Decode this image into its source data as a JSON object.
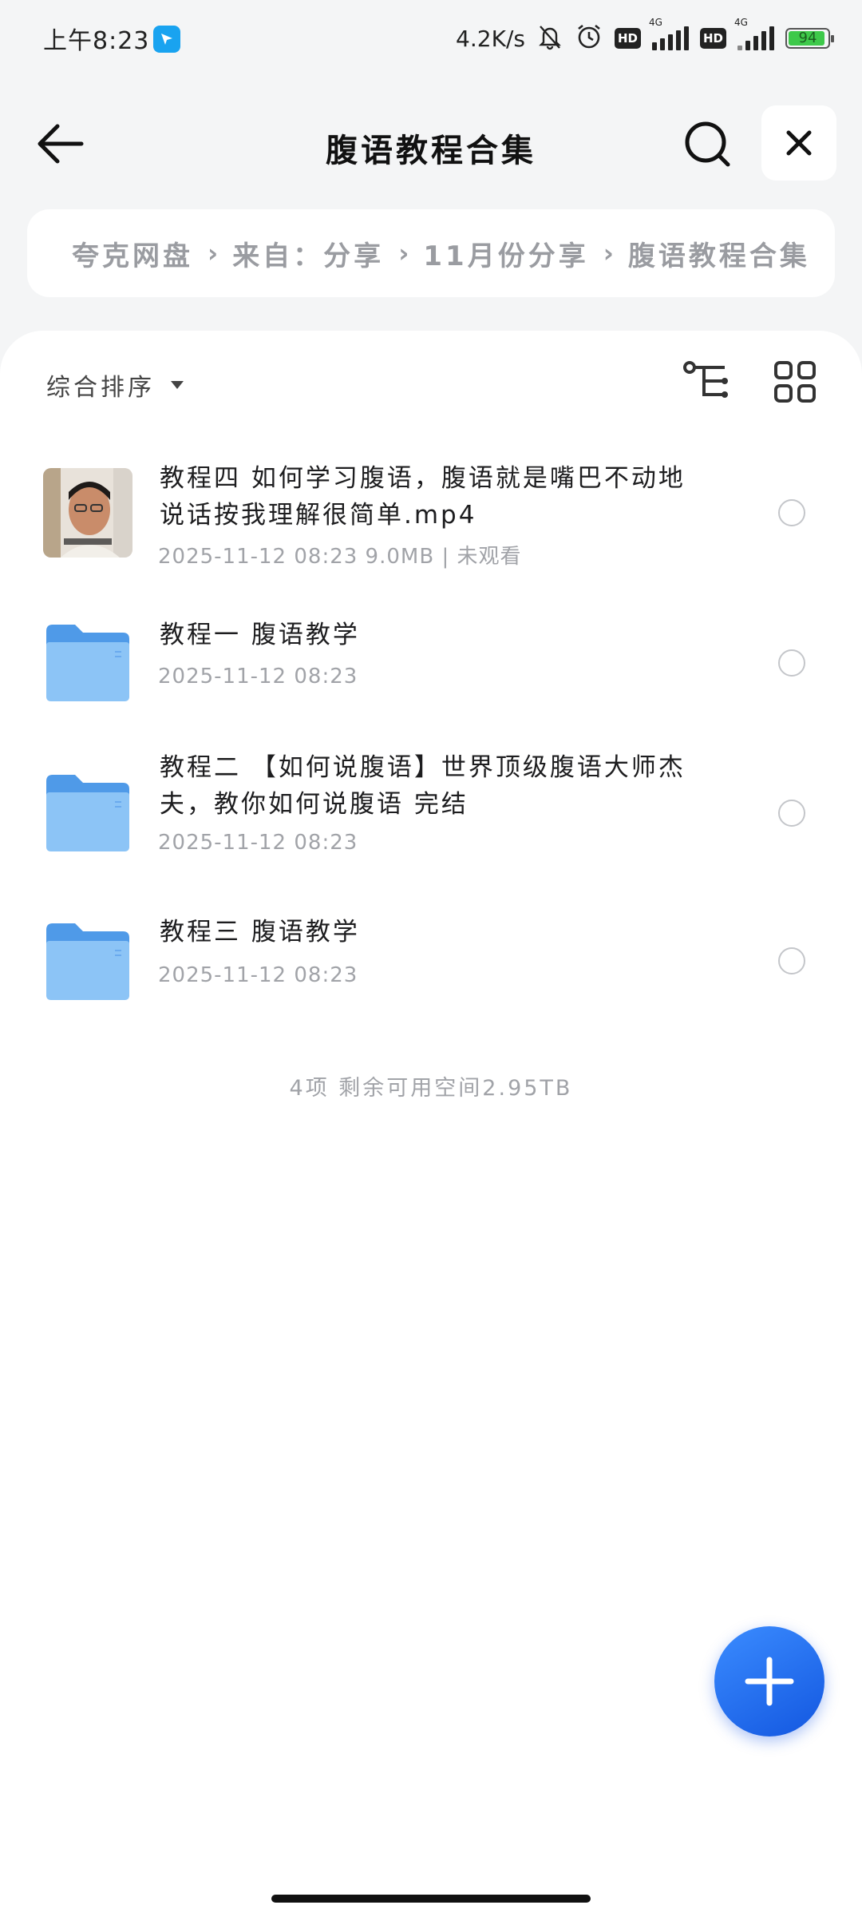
{
  "status_bar": {
    "time": "上午8:23",
    "net_speed": "4.2K/s",
    "hd1": "HD",
    "hd2": "HD",
    "sim1_type": "4G",
    "sim2_type": "4G",
    "battery": "94"
  },
  "header": {
    "title": "腹语教程合集",
    "icons": {
      "back": "arrow-left-icon",
      "search": "search-icon",
      "close": "close-icon"
    }
  },
  "breadcrumb": [
    "夸克网盘",
    "来自：分享",
    "11月份分享",
    "腹语教程合集"
  ],
  "toolbar": {
    "sort_label": "综合排序"
  },
  "files": [
    {
      "type": "video",
      "name": "教程四 如何学习腹语，腹语就是嘴巴不动地说话按我理解很简单.mp4",
      "meta": "2025-11-12 08:23   9.0MB | 未观看"
    },
    {
      "type": "folder",
      "name": "教程一 腹语教学",
      "meta": "2025-11-12 08:23"
    },
    {
      "type": "folder",
      "name": "教程二 【如何说腹语】世界顶级腹语大师杰夫，教你如何说腹语 完结",
      "meta": "2025-11-12 08:23"
    },
    {
      "type": "folder",
      "name": "教程三 腹语教学",
      "meta": "2025-11-12 08:23"
    }
  ],
  "footer": {
    "info": "4项 剩余可用空间2.95TB"
  },
  "colors": {
    "accent": "#1f6cf0",
    "folder": "#5aaaf0",
    "text_secondary": "#a1a3a8"
  }
}
